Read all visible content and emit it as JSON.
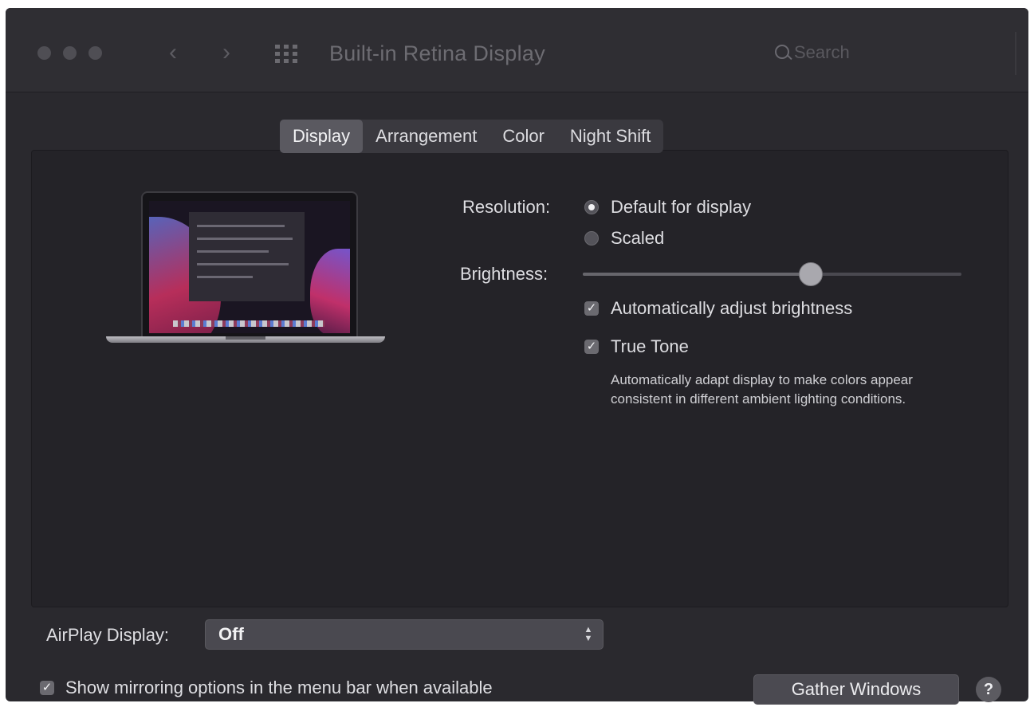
{
  "window": {
    "title": "Built-in Retina Display",
    "search_placeholder": "Search"
  },
  "icons": {
    "back": "chevron-left-icon",
    "forward": "chevron-right-icon",
    "grid": "grid-icon",
    "search": "search-icon",
    "help": "question-icon"
  },
  "tabs": [
    {
      "label": "Display",
      "active": true
    },
    {
      "label": "Arrangement",
      "active": false
    },
    {
      "label": "Color",
      "active": false
    },
    {
      "label": "Night Shift",
      "active": false
    }
  ],
  "resolution": {
    "label": "Resolution:",
    "options": [
      {
        "label": "Default for display",
        "selected": true
      },
      {
        "label": "Scaled",
        "selected": false
      }
    ]
  },
  "brightness": {
    "label": "Brightness:",
    "level": 0.6,
    "auto_adjust": {
      "label": "Automatically adjust brightness",
      "checked": true
    }
  },
  "true_tone": {
    "label": "True Tone",
    "checked": true,
    "description": "Automatically adapt display to make colors appear consistent in different ambient lighting conditions."
  },
  "airplay": {
    "label": "AirPlay Display:",
    "value": "Off"
  },
  "mirroring": {
    "label": "Show mirroring options in the menu bar when available",
    "checked": true
  },
  "buttons": {
    "gather_windows": "Gather Windows",
    "help": "?"
  },
  "colors": {
    "window_bg": "#2a292e",
    "panel_bg": "#242328",
    "control_bg": "#4a4950"
  }
}
